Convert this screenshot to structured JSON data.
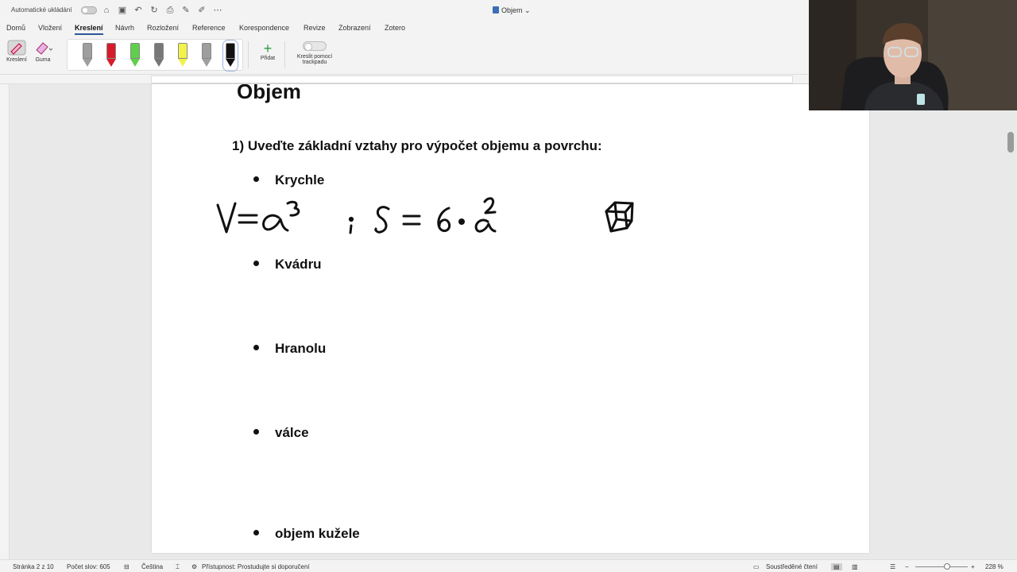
{
  "titlebar": {
    "autosave_label": "Automatické ukládání",
    "document_title": "Objem ⌄"
  },
  "tabs": [
    "Domů",
    "Vložení",
    "Kreslení",
    "Návrh",
    "Rozložení",
    "Reference",
    "Korespondence",
    "Revize",
    "Zobrazení",
    "Zotero"
  ],
  "active_tab": "Kreslení",
  "ribbon": {
    "draw_label": "Kreslení",
    "eraser_label": "Guma",
    "add_label": "Přidat",
    "trackpad_label_1": "Kreslit pomocí",
    "trackpad_label_2": "trackpadu",
    "pen_colors": [
      "#9e9e9e",
      "#d81b2a",
      "#5fd04a",
      "#777777",
      "#f2f24a",
      "#9e9e9e",
      "#111111"
    ]
  },
  "document": {
    "heading": "Objem",
    "question": "1)  Uveďte základní vztahy pro výpočet objemu a povrchu:",
    "bullets": [
      "Krychle",
      "Kvádru",
      "Hranolu",
      "válce",
      "objem kužele"
    ]
  },
  "statusbar": {
    "page": "Stránka 2 z 10",
    "words": "Počet slov: 605",
    "language": "Čeština",
    "accessibility": "Přístupnost: Prostudujte si doporučení",
    "focus": "Soustředěné čtení",
    "zoom": "228 %"
  }
}
